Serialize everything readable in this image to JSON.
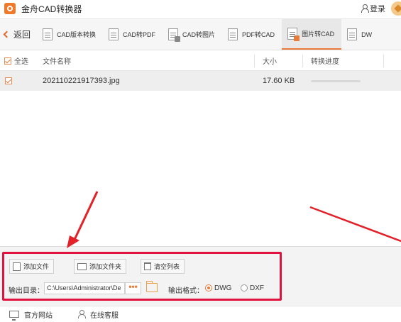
{
  "app": {
    "title": "金舟CAD转换器",
    "login_label": "登录"
  },
  "tabbar": {
    "back_label": "返回",
    "tabs": [
      {
        "label": "CAD版本转换",
        "icon": "cad-version-icon",
        "active": false
      },
      {
        "label": "CAD转PDF",
        "icon": "cad-to-pdf-icon",
        "active": false
      },
      {
        "label": "CAD转图片",
        "icon": "cad-to-image-icon",
        "active": false
      },
      {
        "label": "PDF转CAD",
        "icon": "pdf-to-cad-icon",
        "active": false
      },
      {
        "label": "图片转CAD",
        "icon": "image-to-cad-icon",
        "active": true
      },
      {
        "label": "DW",
        "icon": "dwg-icon",
        "active": false
      }
    ]
  },
  "table": {
    "headers": {
      "select_all": "全选",
      "name": "文件名称",
      "size": "大小",
      "progress": "转换进度"
    },
    "rows": [
      {
        "checked": true,
        "name": "202110221917393.jpg",
        "size": "17.60 KB",
        "progress": 0
      }
    ]
  },
  "panel": {
    "add_file": "添加文件",
    "add_folder": "添加文件夹",
    "clear_list": "清空列表",
    "output_dir_label": "输出目录：",
    "output_dir_value": "C:\\Users\\Administrator\\De",
    "browse_label": "•••",
    "output_format_label": "输出格式：",
    "formats": [
      {
        "label": "DWG",
        "selected": true
      },
      {
        "label": "DXF",
        "selected": false
      }
    ]
  },
  "footer": {
    "website": "官方网站",
    "service": "在线客服"
  },
  "colors": {
    "accent": "#e87b3a",
    "highlight_box": "#e2123f",
    "arrow": "#e32129"
  }
}
